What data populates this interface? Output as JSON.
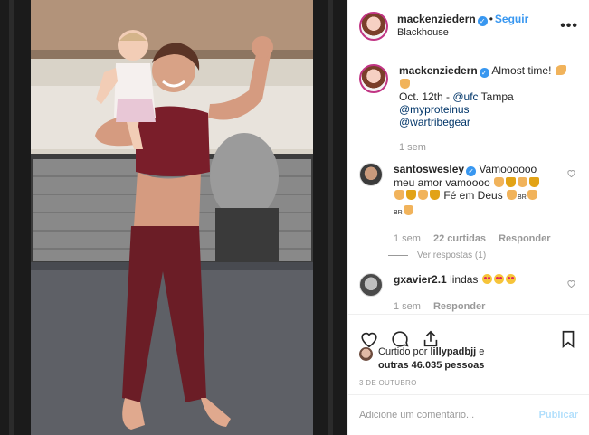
{
  "post": {
    "author": "mackenziedern",
    "follow_label": "Seguir",
    "location": "Blackhouse",
    "more_icon": "more-icon",
    "image_icon": "photo"
  },
  "caption": {
    "user": "mackenziedern",
    "text": "Almost time!",
    "line2": "Oct. 12th - ",
    "mention_ufc": "@ufc",
    "city": " Tampa",
    "mention1": "@myproteinus",
    "mention2": "@wartribegear",
    "time": "1 sem"
  },
  "comments": [
    {
      "user": "santoswesley",
      "text_a": "Vamoooooo",
      "text_b": "meu amor vamoooo",
      "text_c": "Fé em Deus",
      "flag": "BR",
      "time": "1 sem",
      "likes": "22 curtidas",
      "reply": "Responder",
      "view_replies": "Ver respostas (1)"
    },
    {
      "user": "gxavier2.1",
      "text": "lindas",
      "time": "1 sem",
      "reply": "Responder"
    }
  ],
  "actions": {
    "like": "heart-icon",
    "comment": "comment-icon",
    "share": "share-icon",
    "save": "bookmark-icon"
  },
  "likes": {
    "prefix": "Curtido por ",
    "user": "lillypadbjj",
    "mid": " e",
    "rest": "outras 46.035 pessoas"
  },
  "date": "3 DE OUTUBRO",
  "add_comment": {
    "placeholder": "Adicione um comentário...",
    "publish": "Publicar"
  }
}
